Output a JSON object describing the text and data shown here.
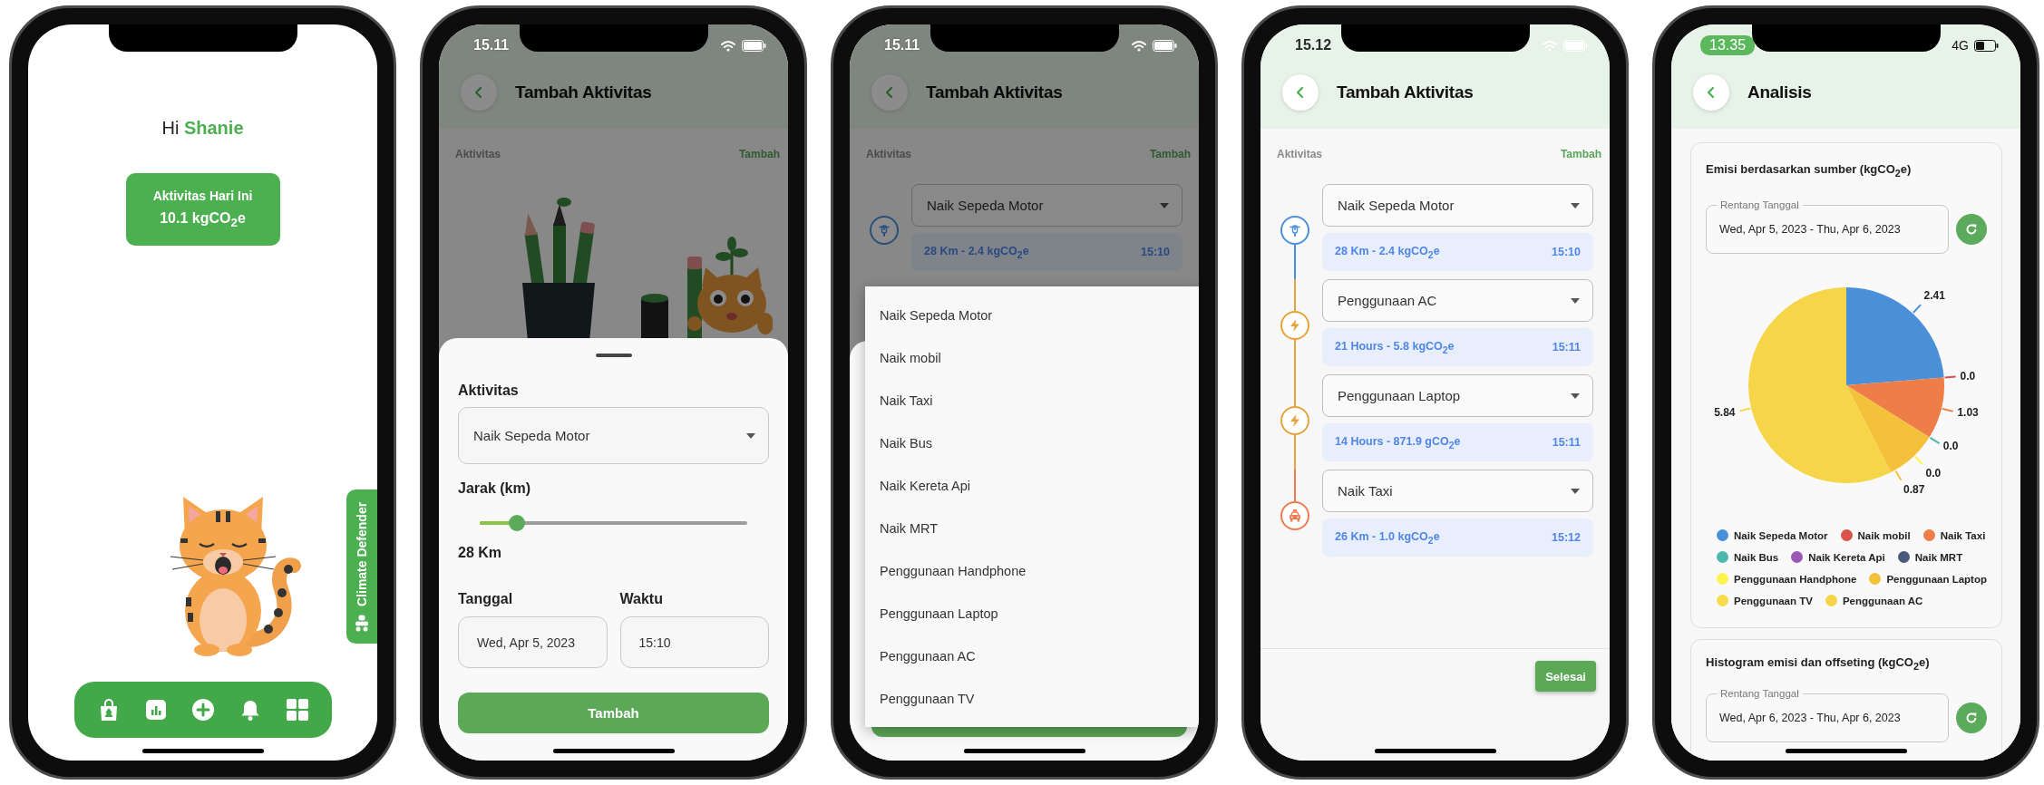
{
  "home_screen": {
    "greeting": "Hi",
    "user_name": "Shanie",
    "summary_card": {
      "title": "Aktivitas Hari Ini",
      "value": "10.1 kgCO$_{2}$e"
    },
    "side_tab": {
      "label": "Climate Defender"
    }
  },
  "add_activity_sheet_screen": {
    "status_time": "15.11",
    "title": "Tambah Aktivitas",
    "section_label": "Aktivitas",
    "add_link": "Tambah",
    "sheet": {
      "activity_label": "Aktivitas",
      "activity_value": "Naik Sepeda Motor",
      "distance_label": "Jarak (km)",
      "distance_slider": {
        "level": 0.14
      },
      "distance_value": "28 Km",
      "date_label": "Tanggal",
      "date_value": "Wed, Apr 5, 2023",
      "time_label": "Waktu",
      "time_value": "15:10",
      "submit_button": "Tambah"
    }
  },
  "activity_dropdown_screen": {
    "status_time": "15.11",
    "title": "Tambah Aktivitas",
    "section_label": "Aktivitas",
    "add_link": "Tambah",
    "entries": [
      {
        "kind": "motorcycle",
        "activity": "Naik Sepeda Motor",
        "detail": "28 Km - 2.4 kgCO$_{2}$e",
        "time": "15:10"
      }
    ],
    "menu_options": [
      "Naik Sepeda Motor",
      "Naik mobil",
      "Naik Taxi",
      "Naik Bus",
      "Naik Kereta Api",
      "Naik MRT",
      "Penggunaan Handphone",
      "Penggunaan Laptop",
      "Penggunaan AC",
      "Penggunaan TV"
    ]
  },
  "activity_list_screen": {
    "status_time": "15.12",
    "title": "Tambah Aktivitas",
    "section_label": "Aktivitas",
    "add_link": "Tambah",
    "entries": [
      {
        "kind": "motorcycle",
        "color": "#4a90d9",
        "activity": "Naik Sepeda Motor",
        "detail": "28 Km - 2.4 kgCO$_{2}$e",
        "time": "15:10"
      },
      {
        "kind": "electricity",
        "color": "#e8a33a",
        "activity": "Penggunaan AC",
        "detail": "21 Hours - 5.8 kgCO$_{2}$e",
        "time": "15:11"
      },
      {
        "kind": "electricity",
        "color": "#e8a33b",
        "activity": "Penggunaan Laptop",
        "detail": "14 Hours - 871.9 gCO$_{2}$e",
        "time": "15:11"
      },
      {
        "kind": "taxi",
        "color": "#ee7b4f",
        "activity": "Naik Taxi",
        "detail": "26 Km - 1.0 kgCO$_{2}$e",
        "time": "15:12"
      }
    ],
    "done_button": "Selesai"
  },
  "analysis_screen": {
    "status_time": "13.35",
    "network": "4G",
    "title": "Analisis",
    "source_card": {
      "title": "Emisi berdasarkan sumber (kgCO$_{2}$e)",
      "date_range": {
        "label": "Rentang Tanggal",
        "value": "Wed, Apr 5, 2023 - Thu, Apr 6, 2023"
      },
      "chart_data": {
        "type": "pie",
        "categories": [
          "Naik Sepeda Motor",
          "Naik mobil",
          "Naik Taxi",
          "Naik Bus",
          "Naik Kereta Api",
          "Naik MRT",
          "Penggunaan Handphone",
          "Penggunaan Laptop",
          "Penggunaan TV",
          "Penggunaan AC"
        ],
        "values": [
          2.41,
          0.0,
          1.03,
          0.0,
          null,
          null,
          0.0,
          0.87,
          null,
          5.84
        ],
        "colors": [
          "#4a90d9",
          "#d9534a",
          "#ef7d48",
          "#4bb8b0",
          "#9a59b5",
          "#4a5a7a",
          "#fff44f",
          "#f3c13a",
          "#f7dc50",
          "#f6d648"
        ],
        "value_labels": [
          "2.41",
          "0.0",
          "1.03",
          "0.0",
          null,
          null,
          "0.0",
          "0.87",
          null,
          "5.84"
        ]
      }
    },
    "histogram_card": {
      "title": "Histogram emisi dan offseting (kgCO$_{2}$e)",
      "date_range": {
        "label": "Rentang Tanggal",
        "value": "Wed, Apr 6, 2023 - Thu, Apr 6, 2023"
      }
    }
  }
}
